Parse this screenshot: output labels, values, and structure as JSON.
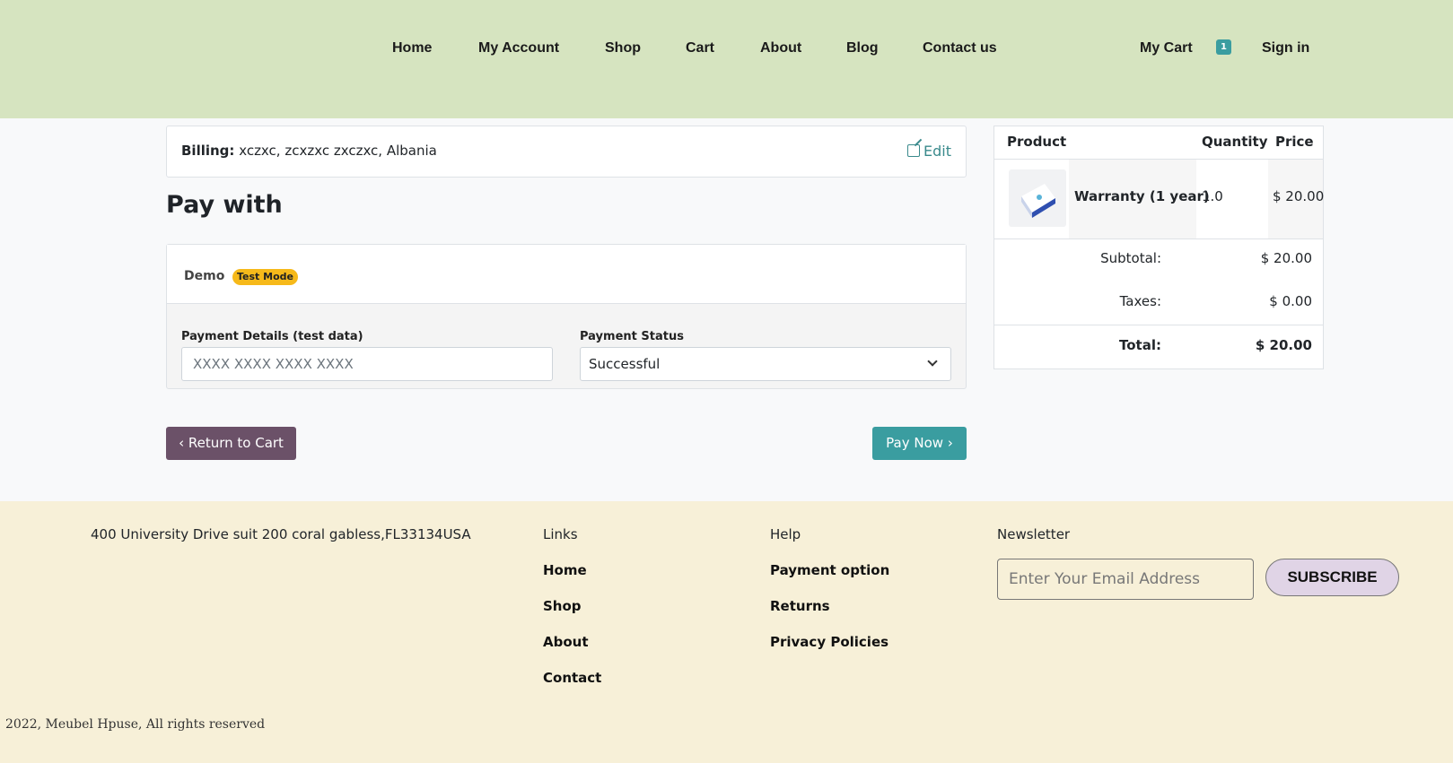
{
  "nav": {
    "items": [
      "Home",
      "My Account",
      "Shop",
      "Cart",
      "About",
      "Blog",
      "Contact us"
    ],
    "my_cart": "My Cart",
    "cart_count": "1",
    "sign_in": "Sign in"
  },
  "billing": {
    "label": "Billing:",
    "address": "xczxc, zcxzxc zxczxc, Albania",
    "edit": "Edit"
  },
  "pay_with": "Pay with",
  "payment": {
    "provider": "Demo",
    "badge": "Test Mode",
    "details_label": "Payment Details (test data)",
    "details_placeholder": "XXXX XXXX XXXX XXXX",
    "status_label": "Payment Status",
    "status_value": "Successful"
  },
  "buttons": {
    "return": "Return to Cart",
    "pay": "Pay Now"
  },
  "summary": {
    "headers": {
      "product": "Product",
      "quantity": "Quantity",
      "price": "Price"
    },
    "item": {
      "name": "Warranty (1 year)",
      "quantity": "1.0",
      "price": "$ 20.00"
    },
    "subtotal_label": "Subtotal:",
    "subtotal": "$ 20.00",
    "taxes_label": "Taxes:",
    "taxes": "$ 0.00",
    "total_label": "Total:",
    "total": "$ 20.00"
  },
  "footer": {
    "address": "400 University Drive suit 200 coral gabless,FL33134USA",
    "links_title": "Links",
    "links": [
      "Home",
      "Shop",
      "About",
      "Contact"
    ],
    "help_title": "Help",
    "help": [
      "Payment option",
      "Returns",
      "Privacy Policies"
    ],
    "newsletter_title": "Newsletter",
    "email_placeholder": "Enter Your Email Address",
    "subscribe": "SUBSCRIBE",
    "copyright": "2022, Meubel Hpuse, All rights reserved"
  },
  "colors": {
    "header_bg": "#d6e4c0",
    "footer_bg": "#f7f0d8",
    "primary": "#3a9da0",
    "secondary": "#6b5168",
    "badge": "#f6b91a"
  }
}
